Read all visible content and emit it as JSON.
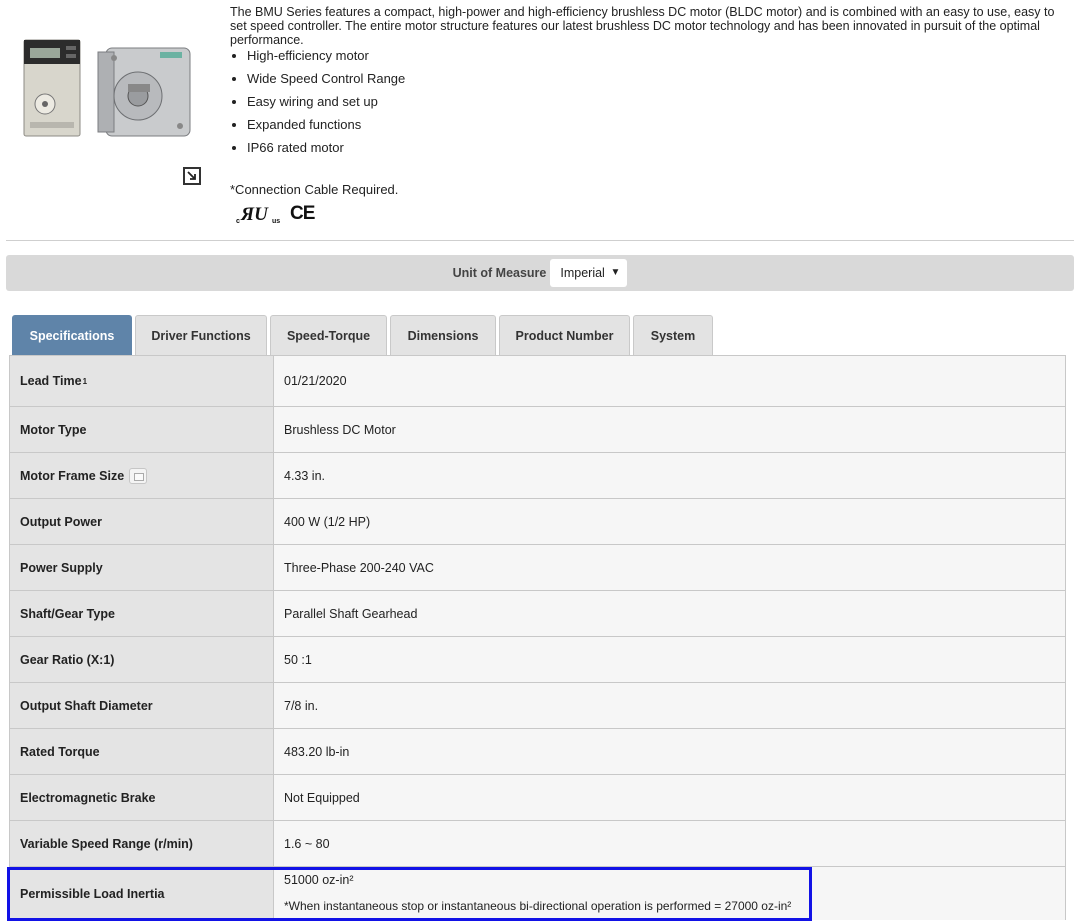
{
  "product": {
    "description": "The BMU Series features a compact, high-power and high-efficiency brushless DC motor (BLDC motor) and is combined with an easy to use, easy to set speed controller. The entire motor structure features our latest brushless DC motor technology and has been innovated in pursuit of the optimal performance.",
    "features": [
      "High-efficiency motor",
      "Wide Speed Control Range",
      "Easy wiring and set up",
      "Expanded functions",
      "IP66 rated motor"
    ],
    "cable_note": "*Connection Cable Required.",
    "certifications": {
      "ul": "cULus",
      "ce": "CE"
    },
    "icons": {
      "image": "motor-product-image",
      "enlarge": "enlarge-icon"
    }
  },
  "unit_of_measure": {
    "label": "Unit of Measure",
    "selected": "Imperial",
    "arrow": "▼"
  },
  "tabs": [
    {
      "label": "Specifications",
      "active": true
    },
    {
      "label": "Driver Functions",
      "active": false
    },
    {
      "label": "Speed-Torque",
      "active": false
    },
    {
      "label": "Dimensions",
      "active": false
    },
    {
      "label": "Product Number",
      "active": false
    },
    {
      "label": "System",
      "active": false
    }
  ],
  "specs": [
    {
      "label": "Lead Time",
      "sup": "1",
      "value": "01/21/2020"
    },
    {
      "label": "Motor Type",
      "value": "Brushless DC Motor"
    },
    {
      "label": "Motor Frame Size",
      "value": "4.33 in.",
      "icon": "image-info-icon"
    },
    {
      "label": "Output Power",
      "value": "400 W (1/2 HP)"
    },
    {
      "label": "Power Supply",
      "value": "Three-Phase 200-240 VAC"
    },
    {
      "label": "Shaft/Gear Type",
      "value": "Parallel Shaft Gearhead"
    },
    {
      "label": "Gear Ratio (X:1)",
      "value": "50 :1"
    },
    {
      "label": "Output Shaft Diameter",
      "value": "7/8 in."
    },
    {
      "label": "Rated Torque",
      "value": "483.20 lb-in"
    },
    {
      "label": "Electromagnetic Brake",
      "value": "Not Equipped"
    },
    {
      "label": "Variable Speed Range (r/min)",
      "value": "1.6 ~ 80"
    },
    {
      "label": "Permissible Load Inertia",
      "value": "51000 oz-in²",
      "note": "*When instantaneous stop or instantaneous bi-directional operation is performed = 27000 oz-in²"
    }
  ],
  "colors": {
    "active_tab": "#5f84a9",
    "highlight": "#1212e6",
    "label_bg": "#e4e4e4",
    "value_bg": "#f6f6f6"
  }
}
